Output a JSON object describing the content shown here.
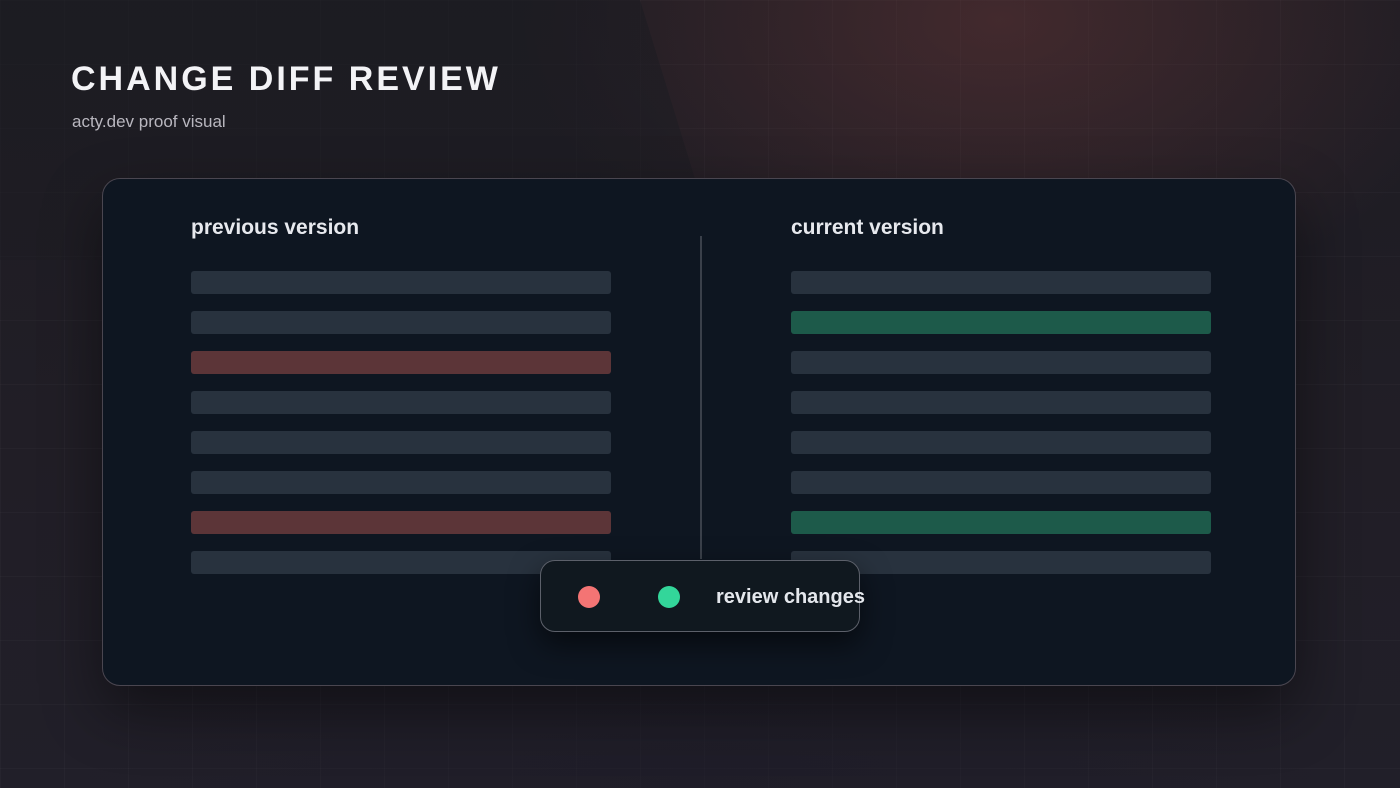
{
  "header": {
    "title": "CHANGE DIFF REVIEW",
    "subtitle": "acty.dev proof visual"
  },
  "diff": {
    "previous": {
      "label": "previous version",
      "lines": [
        "unchanged",
        "unchanged",
        "removed",
        "unchanged",
        "unchanged",
        "unchanged",
        "removed",
        "unchanged"
      ]
    },
    "current": {
      "label": "current version",
      "lines": [
        "unchanged",
        "added",
        "unchanged",
        "unchanged",
        "unchanged",
        "unchanged",
        "added",
        "unchanged"
      ]
    }
  },
  "review": {
    "label": "review changes",
    "removed_color": "#f47474",
    "added_color": "#33d69a"
  },
  "colors": {
    "removed_line": "#5c3538",
    "added_line": "#1d5a4a",
    "unchanged_line": "#28323e"
  }
}
